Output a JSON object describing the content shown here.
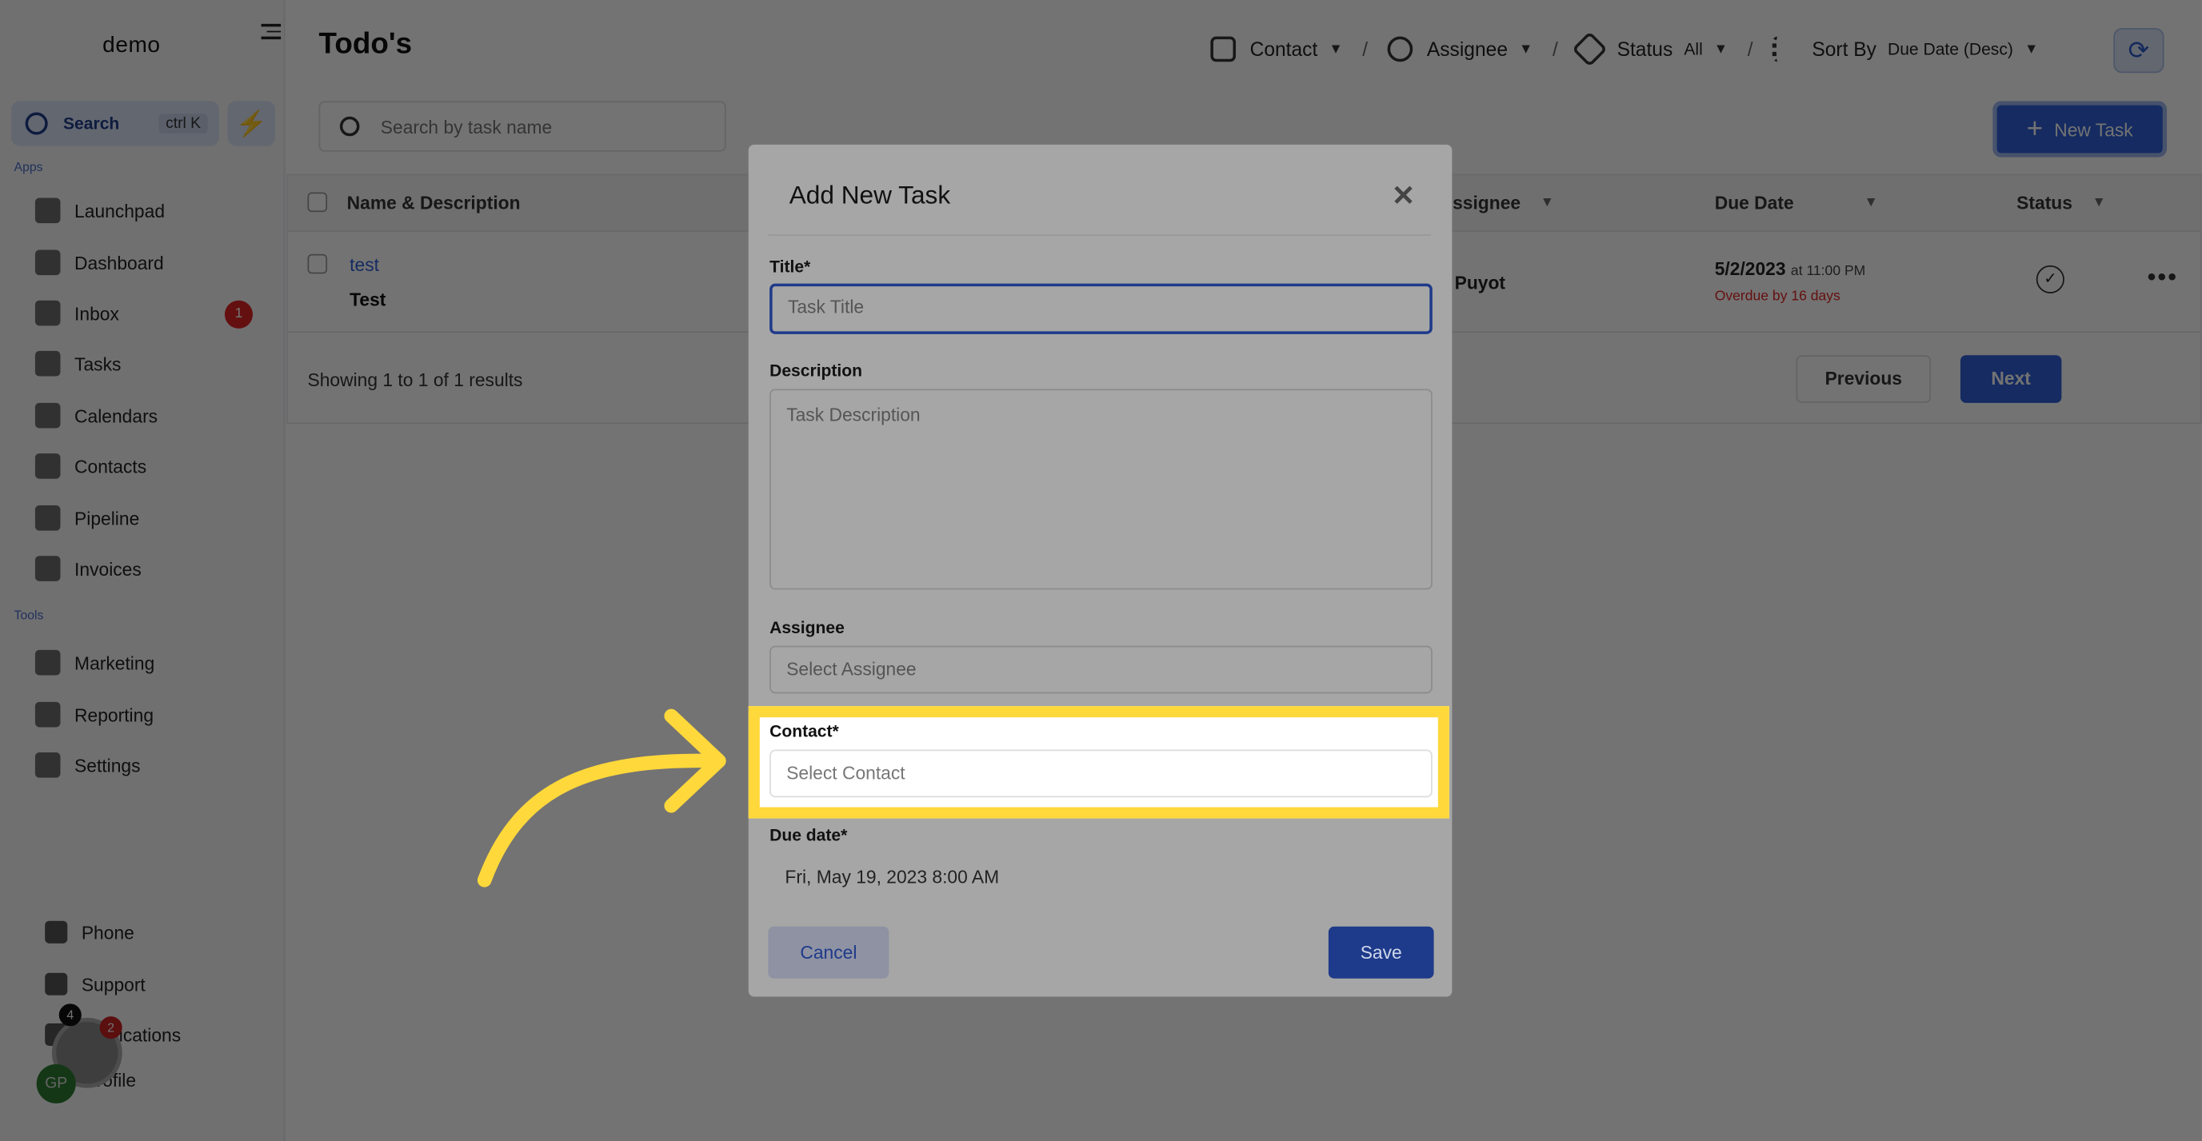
{
  "app": {
    "brand": "demo"
  },
  "sidebar": {
    "search_label": "Search",
    "search_shortcut": "ctrl K",
    "apps_label": "Apps",
    "tools_label": "Tools",
    "apps": [
      {
        "label": "Launchpad",
        "icon": "rocket-icon"
      },
      {
        "label": "Dashboard",
        "icon": "dashboard-icon"
      },
      {
        "label": "Inbox",
        "icon": "inbox-icon",
        "badge": "1"
      },
      {
        "label": "Tasks",
        "icon": "tasks-icon"
      },
      {
        "label": "Calendars",
        "icon": "calendar-icon"
      },
      {
        "label": "Contacts",
        "icon": "contacts-icon"
      },
      {
        "label": "Pipeline",
        "icon": "pipeline-icon"
      },
      {
        "label": "Invoices",
        "icon": "invoice-icon"
      }
    ],
    "tools": [
      {
        "label": "Marketing",
        "icon": "megaphone-icon"
      },
      {
        "label": "Reporting",
        "icon": "chart-icon"
      },
      {
        "label": "Settings",
        "icon": "gear-icon"
      }
    ],
    "bottom": [
      {
        "label": "Phone",
        "icon": "phone-icon"
      },
      {
        "label": "Support",
        "icon": "support-icon"
      },
      {
        "label": "Notifications",
        "icon": "bell-icon",
        "badge": "4"
      },
      {
        "label": "Profile",
        "icon": "avatar-icon"
      }
    ],
    "chat_badge": "2",
    "avatar_initials": "GP"
  },
  "header": {
    "title": "Todo's",
    "filters": {
      "contact": "Contact",
      "assignee": "Assignee",
      "status_label": "Status",
      "status_value": "All",
      "sort_label": "Sort By",
      "sort_value": "Due Date (Desc)"
    },
    "search_placeholder": "Search by task name",
    "new_task": "New Task"
  },
  "table": {
    "columns": [
      "Name & Description",
      "Assignee",
      "Due Date",
      "Status"
    ],
    "rows": [
      {
        "name": "test",
        "description": "Test",
        "assignee": "e Puyot",
        "due_date": "5/2/2023",
        "due_time": "at 11:00 PM",
        "overdue": "Overdue by 16 days"
      }
    ],
    "footer": "Showing 1 to 1 of 1 results",
    "previous": "Previous",
    "next": "Next"
  },
  "modal": {
    "title": "Add New Task",
    "title_label": "Title*",
    "title_placeholder": "Task Title",
    "description_label": "Description",
    "description_placeholder": "Task Description",
    "assignee_label": "Assignee",
    "assignee_placeholder": "Select Assignee",
    "contact_label": "Contact*",
    "contact_placeholder": "Select Contact",
    "due_label": "Due date*",
    "due_value": "Fri, May 19, 2023 8:00 AM",
    "cancel": "Cancel",
    "save": "Save"
  },
  "colors": {
    "accent": "#2f5fd8",
    "highlight": "#ffd83b",
    "danger": "#e02424"
  }
}
